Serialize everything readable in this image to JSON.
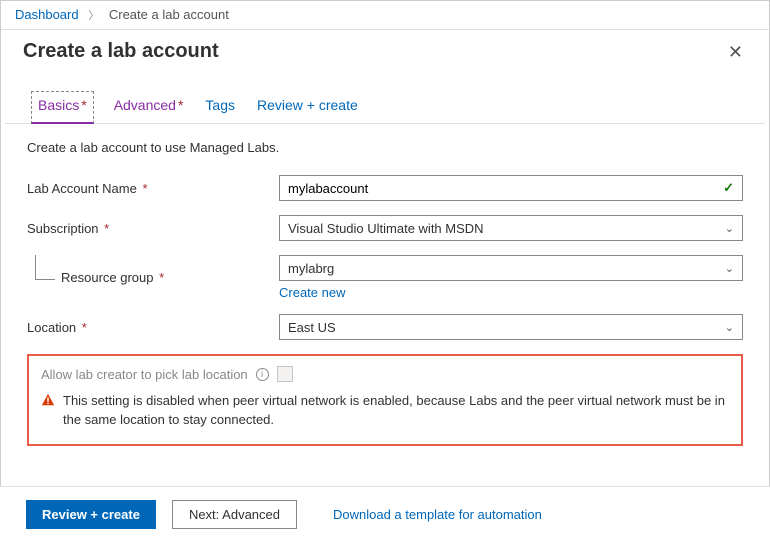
{
  "breadcrumb": {
    "root": "Dashboard",
    "current": "Create a lab account"
  },
  "header": {
    "title": "Create a lab account"
  },
  "tabs": {
    "basics": "Basics",
    "advanced": "Advanced",
    "tags": "Tags",
    "review": "Review + create"
  },
  "intro": "Create a lab account to use Managed Labs.",
  "fields": {
    "lab_name_label": "Lab Account Name",
    "lab_name_value": "mylabaccount",
    "subscription_label": "Subscription",
    "subscription_value": "Visual Studio Ultimate with MSDN",
    "resource_group_label": "Resource group",
    "resource_group_value": "mylabrg",
    "create_new": "Create new",
    "location_label": "Location",
    "location_value": "East US"
  },
  "disabled_section": {
    "label": "Allow lab creator to pick lab location",
    "message": "This setting is disabled when peer virtual network is enabled, because Labs and the peer virtual network must be in the same location to stay connected."
  },
  "footer": {
    "review": "Review + create",
    "next": "Next: Advanced",
    "download": "Download a template for automation"
  }
}
